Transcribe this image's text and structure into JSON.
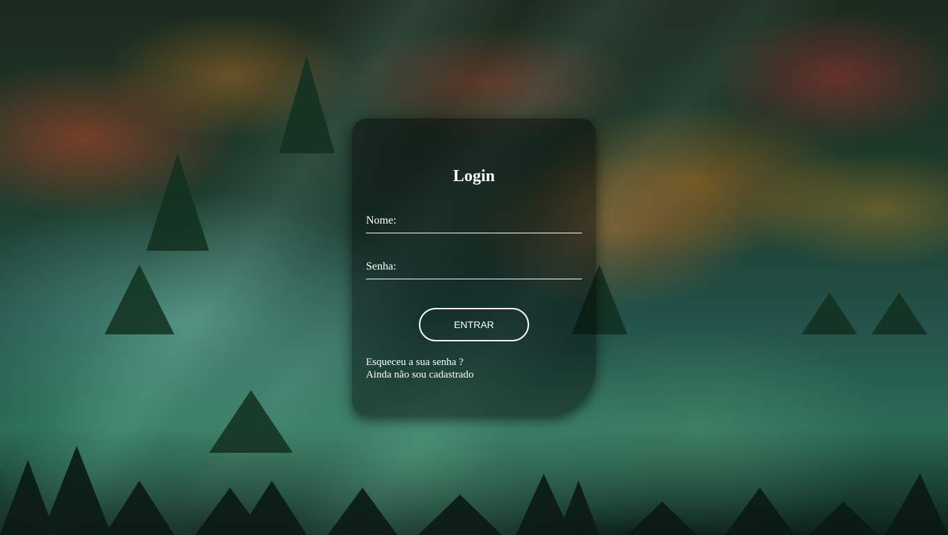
{
  "login": {
    "title": "Login",
    "nome_label": "Nome:",
    "senha_label": "Senha:",
    "submit_label": "ENTRAR",
    "forgot_link": "Esqueceu a sua senha ?",
    "register_link": "Ainda não sou cadastrado"
  },
  "colors": {
    "text": "#ffffff",
    "card_background": "rgba(0,0,0,0.42)",
    "button_border": "#ffffff"
  }
}
